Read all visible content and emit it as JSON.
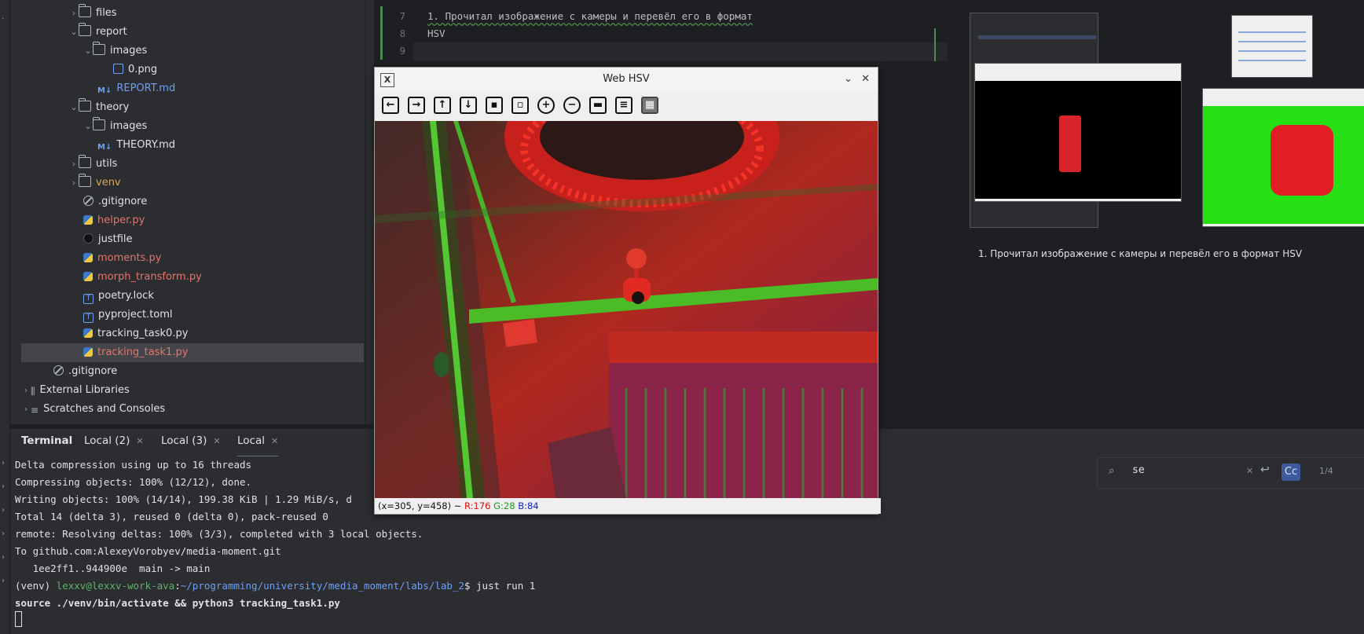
{
  "tree": {
    "items": [
      {
        "label": "files",
        "kind": "folder",
        "open": false
      },
      {
        "label": "report",
        "kind": "folder",
        "open": true
      },
      {
        "label": "images",
        "kind": "folder",
        "open": true
      },
      {
        "label": "0.png",
        "kind": "image"
      },
      {
        "label": "REPORT.md",
        "kind": "markdown"
      },
      {
        "label": "theory",
        "kind": "folder",
        "open": true
      },
      {
        "label": "images",
        "kind": "folder",
        "open": false
      },
      {
        "label": "THEORY.md",
        "kind": "markdown"
      },
      {
        "label": "utils",
        "kind": "folder",
        "open": false
      },
      {
        "label": "venv",
        "kind": "folder",
        "open": false
      },
      {
        "label": ".gitignore",
        "kind": "gitignore"
      },
      {
        "label": "helper.py",
        "kind": "python"
      },
      {
        "label": "justfile",
        "kind": "just"
      },
      {
        "label": "moments.py",
        "kind": "python"
      },
      {
        "label": "morph_transform.py",
        "kind": "python"
      },
      {
        "label": "poetry.lock",
        "kind": "text"
      },
      {
        "label": "pyproject.toml",
        "kind": "text"
      },
      {
        "label": "tracking_task0.py",
        "kind": "python"
      },
      {
        "label": "tracking_task1.py",
        "kind": "python",
        "selected": true
      },
      {
        "label": ".gitignore",
        "kind": "gitignore"
      },
      {
        "label": "External Libraries",
        "kind": "library"
      },
      {
        "label": "Scratches and Consoles",
        "kind": "scratches"
      }
    ]
  },
  "editor": {
    "lines": [
      {
        "num": "7",
        "text": "1. Прочитал изображение с камеры и перевёл его в формат"
      },
      {
        "num": "8",
        "text": "HSV"
      },
      {
        "num": "9",
        "text": ""
      }
    ]
  },
  "preview": {
    "text": "1. Прочитал изображение с камеры и перевёл его в формат HSV"
  },
  "terminal": {
    "tabs": [
      {
        "label": "Terminal",
        "closable": false
      },
      {
        "label": "Local (2)",
        "closable": true
      },
      {
        "label": "Local (3)",
        "closable": true
      },
      {
        "label": "Local",
        "closable": true,
        "active": true
      }
    ],
    "lines": [
      "Delta compression using up to 16 threads",
      "Compressing objects: 100% (12/12), done.",
      "Writing objects: 100% (14/14), 199.38 KiB | 1.29 MiB/s, d",
      "Total 14 (delta 3), reused 0 (delta 0), pack-reused 0",
      "remote: Resolving deltas: 100% (3/3), completed with 3 local objects.",
      "To github.com:AlexeyVorobyev/media-moment.git",
      "   1ee2ff1..944900e  main -> main"
    ],
    "prompt": {
      "env": "(venv) ",
      "user": "lexxv@lexxv-work-ava",
      "colon": ":",
      "path": "~/programming/university/media_moment/labs/lab_2",
      "cmd": "$ just run 1"
    },
    "echo": "source ./venv/bin/activate && python3 tracking_task1.py"
  },
  "search": {
    "value": "se",
    "count": "1/4",
    "case_label": "Cc"
  },
  "popup": {
    "title": "Web HSV",
    "status_coords": "(x=305, y=458) ~",
    "r": "R:176",
    "g": "G:28",
    "b": "B:84",
    "toolbar": [
      "arrow-left-icon",
      "arrow-right-icon",
      "arrow-up-icon",
      "arrow-down-icon",
      "image-icon",
      "image-settings-icon",
      "zoom-in-icon",
      "zoom-out-icon",
      "save-icon",
      "clipboard-icon",
      "properties-icon"
    ]
  },
  "colors": {
    "accent": "#6f9ff5",
    "modified": "#e0766e",
    "prompt_user": "#5fb36a"
  }
}
